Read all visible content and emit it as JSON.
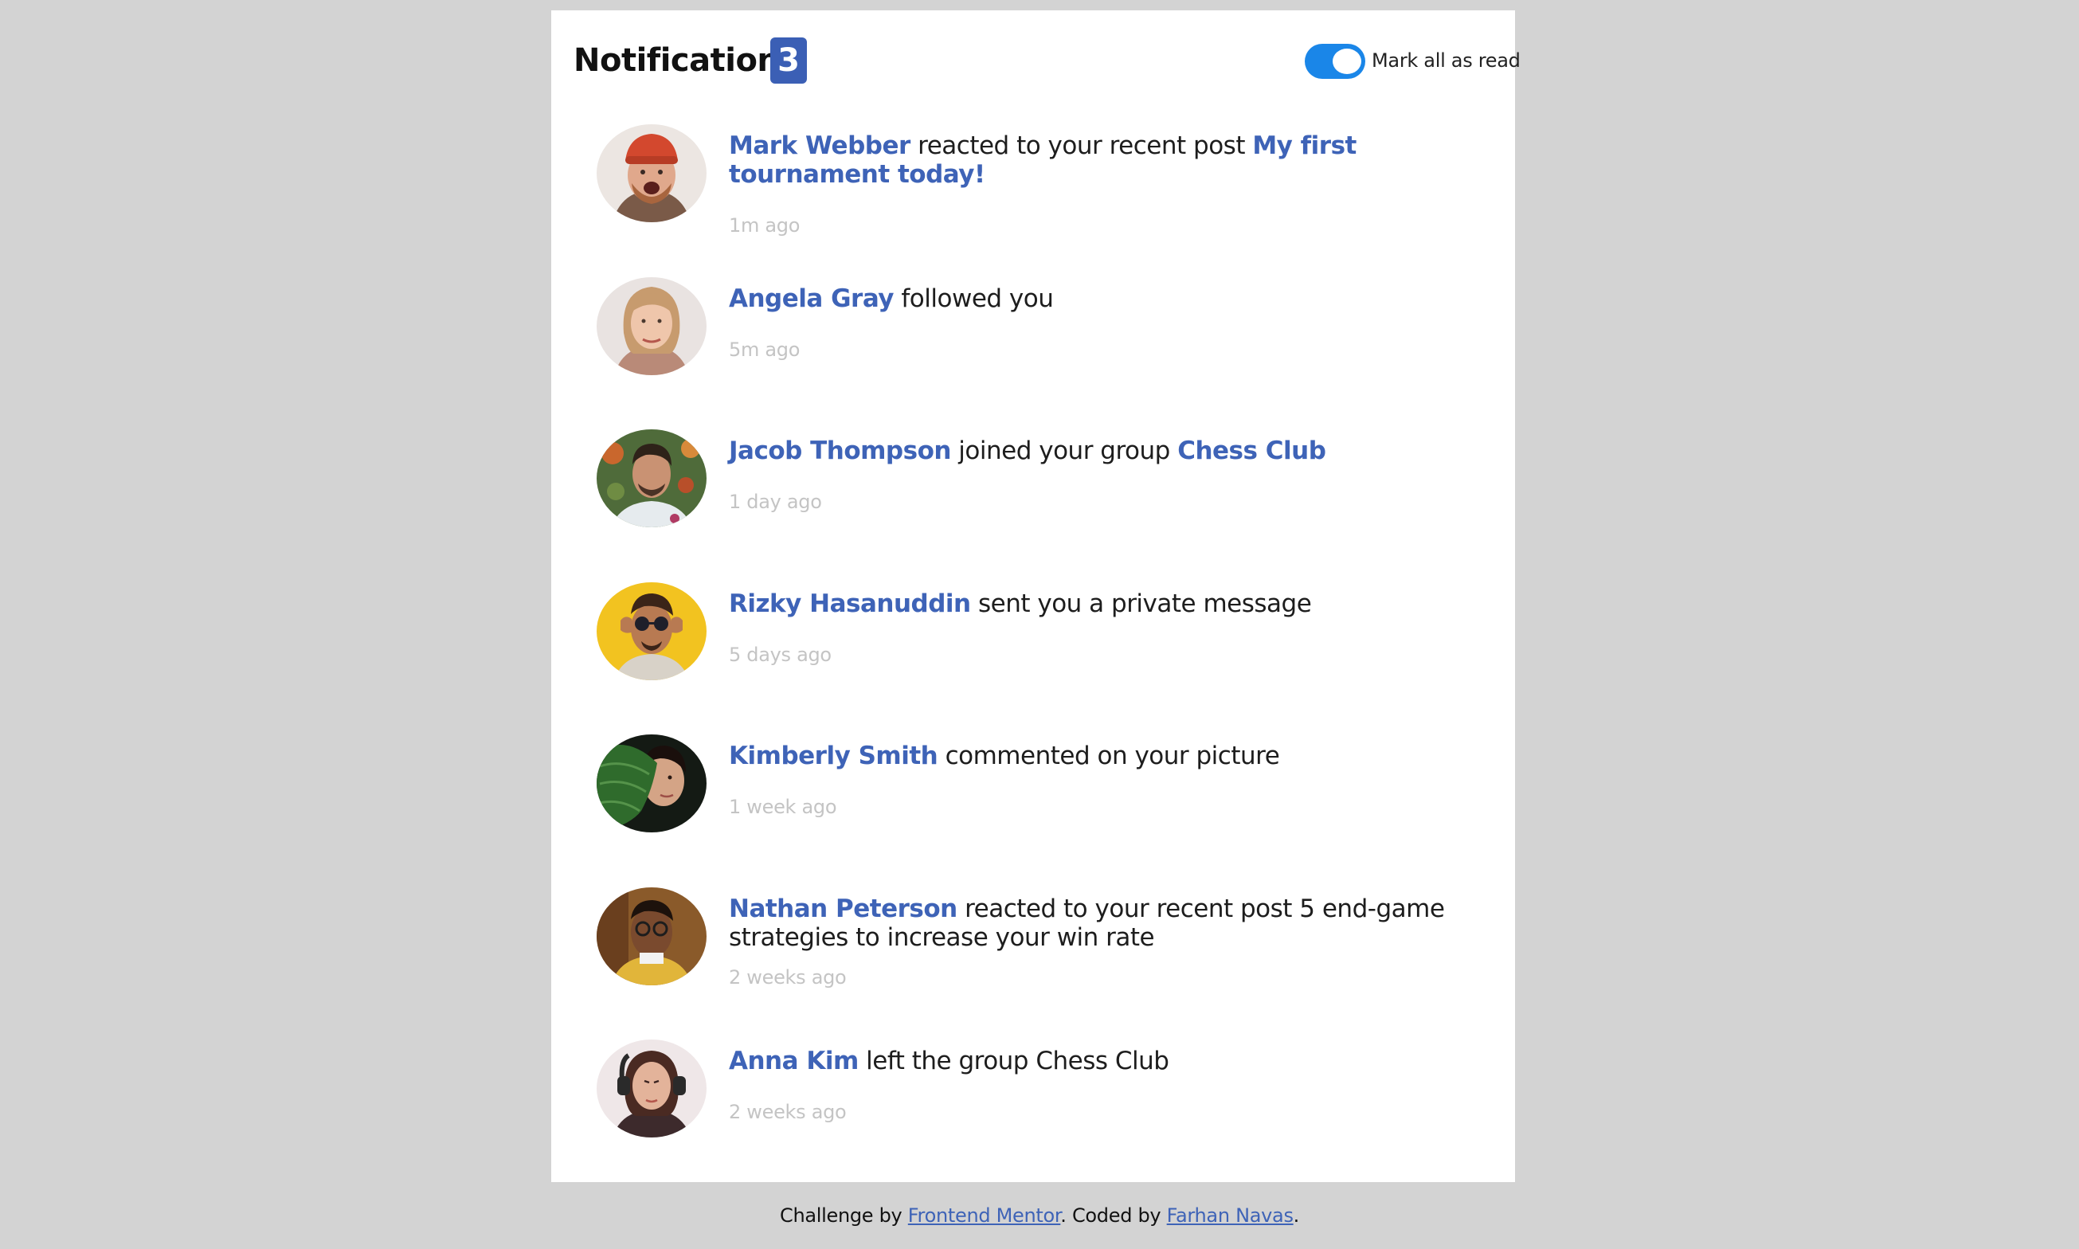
{
  "header": {
    "title": "Notifications",
    "unread_count": "3",
    "mark_all_label": "Mark all as read",
    "toggle_on": true
  },
  "notifications": [
    {
      "name": "Mark Webber",
      "action": "reacted to your recent post",
      "target": "My first tournament today!",
      "target_style": "link",
      "time": "1m ago",
      "avatar": "avatar-mark-webber"
    },
    {
      "name": "Angela Gray",
      "action": "followed you",
      "target": "",
      "target_style": "none",
      "time": "5m ago",
      "avatar": "avatar-angela-gray"
    },
    {
      "name": "Jacob Thompson",
      "action": "joined your group",
      "target": "Chess Club",
      "target_style": "link",
      "time": "1 day ago",
      "avatar": "avatar-jacob-thompson"
    },
    {
      "name": "Rizky Hasanuddin",
      "action": "sent you a private message",
      "target": "",
      "target_style": "none",
      "time": "5 days ago",
      "avatar": "avatar-rizky-hasanuddin"
    },
    {
      "name": "Kimberly Smith",
      "action": "commented on your picture",
      "target": "",
      "target_style": "none",
      "time": "1 week ago",
      "avatar": "avatar-kimberly-smith"
    },
    {
      "name": "Nathan Peterson",
      "action": "reacted to your recent post",
      "target": "5 end-game strategies to increase your win rate",
      "target_style": "plain",
      "time": "2 weeks ago",
      "avatar": "avatar-nathan-peterson"
    },
    {
      "name": "Anna Kim",
      "action": "left the group",
      "target": "Chess Club",
      "target_style": "plain",
      "time": "2 weeks ago",
      "avatar": "avatar-anna-kim"
    }
  ],
  "footer": {
    "prefix": "Challenge by",
    "challenge_link": "Frontend Mentor",
    "middle": ". Coded by",
    "author_link": "Farhan Navas",
    "suffix": "."
  },
  "colors": {
    "page_background": "#d3d3d3",
    "card_background": "#ffffff",
    "accent_blue": "#3e63b7",
    "badge_blue": "#3b5fb5",
    "toggle_blue": "#1a86e8",
    "muted_time": "#c4c4c4"
  }
}
